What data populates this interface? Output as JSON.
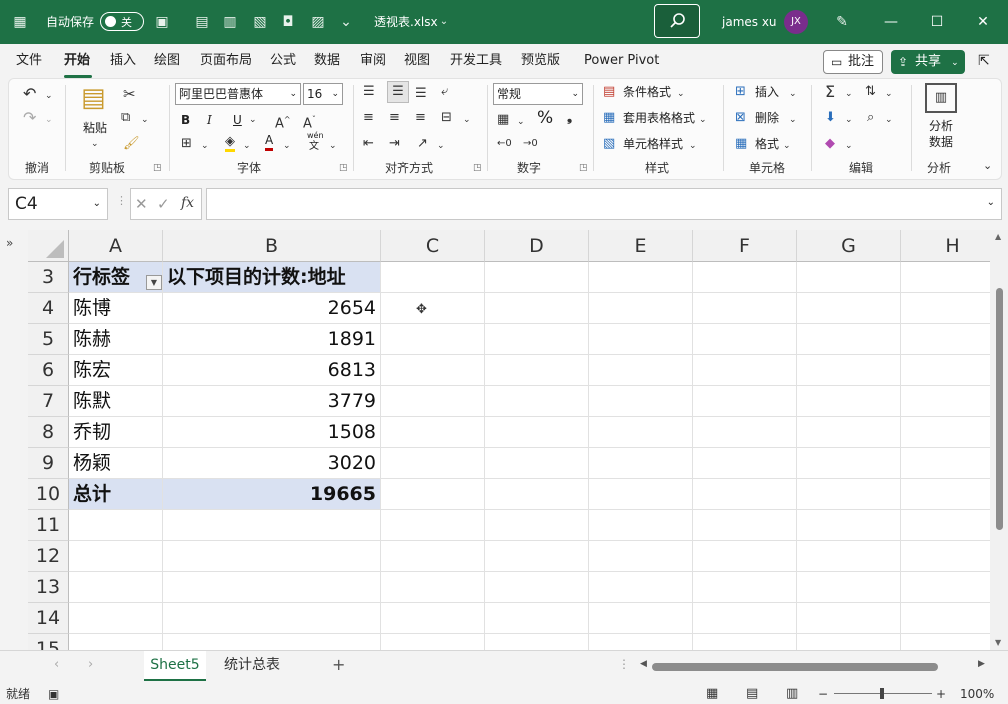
{
  "titlebar": {
    "autosave_label": "自动保存",
    "autosave_state": "关",
    "filename": "透视表.xlsx",
    "user_name": "james xu",
    "user_initials": "JX"
  },
  "menu": {
    "items": [
      "文件",
      "开始",
      "插入",
      "绘图",
      "页面布局",
      "公式",
      "数据",
      "审阅",
      "视图",
      "开发工具",
      "预览版",
      "Power Pivot"
    ],
    "active_index": 1,
    "comments_label": "批注",
    "share_label": "共享"
  },
  "ribbon": {
    "groups": {
      "undo": "撤消",
      "clipboard": "剪贴板",
      "font": "字体",
      "alignment": "对齐方式",
      "number": "数字",
      "styles": "样式",
      "cells": "单元格",
      "editing": "编辑",
      "analysis": "分析"
    },
    "paste_label": "粘贴",
    "font_name": "阿里巴巴普惠体",
    "font_size": "16",
    "number_format": "常规",
    "conditional_format": "条件格式",
    "table_format": "套用表格格式",
    "cell_styles": "单元格样式",
    "insert": "插入",
    "delete": "删除",
    "format": "格式",
    "analyze_data_line1": "分析",
    "analyze_data_line2": "数据",
    "bold": "B",
    "italic": "I",
    "underline": "U",
    "font_color": "A",
    "percent": "%",
    "wen": "wén",
    "wen2": "文"
  },
  "formula_bar": {
    "name_box": "C4",
    "fx": "fx",
    "content": ""
  },
  "grid": {
    "columns": [
      "A",
      "B",
      "C",
      "D",
      "E",
      "F",
      "G",
      "H"
    ],
    "rows": [
      "3",
      "4",
      "5",
      "6",
      "7",
      "8",
      "9",
      "10",
      "11",
      "12",
      "13",
      "14",
      "15"
    ],
    "pivot": {
      "header_a": "行标签",
      "header_b": "以下项目的计数:地址",
      "records": [
        {
          "name": "陈博",
          "value": "2654"
        },
        {
          "name": "陈赫",
          "value": "1891"
        },
        {
          "name": "陈宏",
          "value": "6813"
        },
        {
          "name": "陈默",
          "value": "3779"
        },
        {
          "name": "乔韧",
          "value": "1508"
        },
        {
          "name": "杨颖",
          "value": "3020"
        }
      ],
      "total_label": "总计",
      "total_value": "19665"
    }
  },
  "sheets": {
    "tabs": [
      "Sheet5",
      "统计总表"
    ],
    "active_index": 0
  },
  "status": {
    "ready": "就绪",
    "zoom": "100%"
  },
  "colors": {
    "accent": "#1e7145",
    "pivot_header": "#d9e1f2",
    "avatar": "#7a2d8c"
  }
}
